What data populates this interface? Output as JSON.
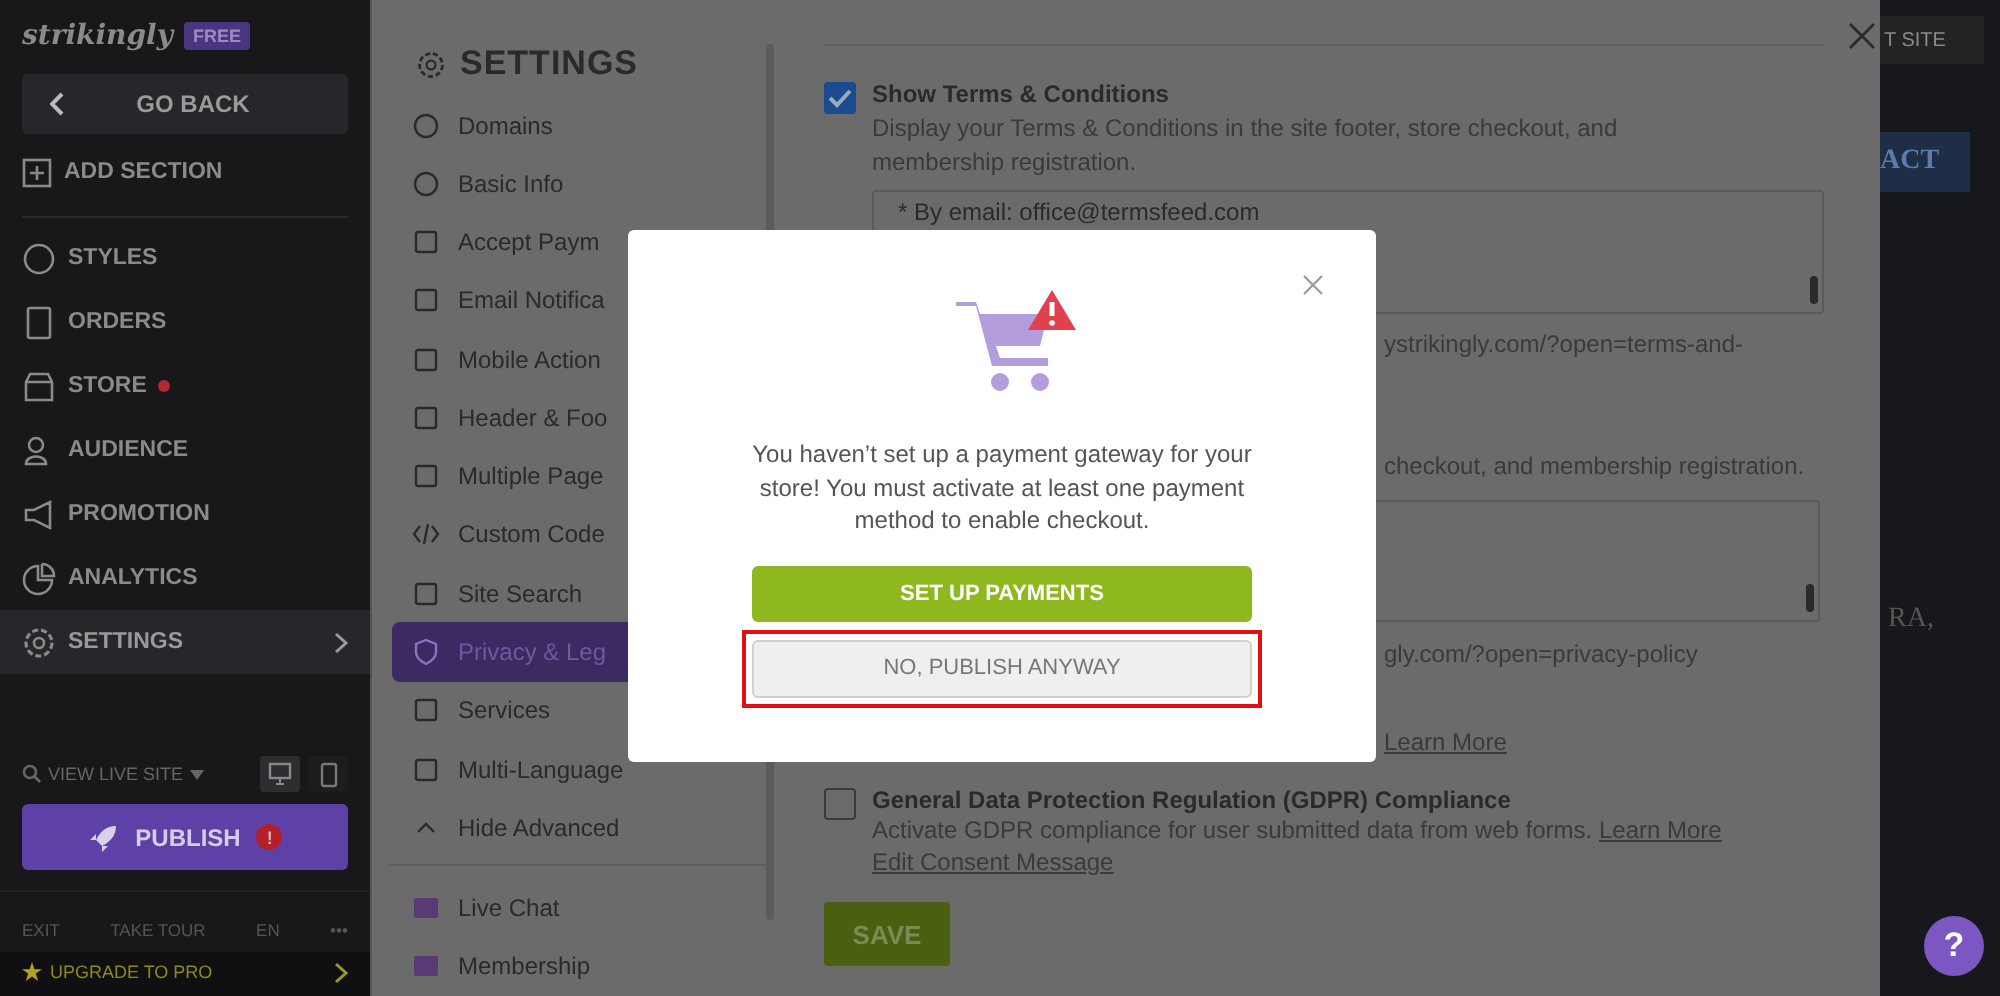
{
  "sidebar": {
    "logo": "strikingly",
    "plan_badge": "FREE",
    "back_button": "GO BACK",
    "add_section": "ADD SECTION",
    "items": [
      {
        "label": "STYLES",
        "selected": false,
        "alert": false
      },
      {
        "label": "ORDERS",
        "selected": false,
        "alert": false
      },
      {
        "label": "STORE",
        "selected": false,
        "alert": true
      },
      {
        "label": "AUDIENCE",
        "selected": false,
        "alert": false
      },
      {
        "label": "PROMOTION",
        "selected": false,
        "alert": false
      },
      {
        "label": "ANALYTICS",
        "selected": false,
        "alert": false
      },
      {
        "label": "SETTINGS",
        "selected": true,
        "alert": false
      }
    ],
    "view_live_site": "VIEW LIVE SITE",
    "devices": [
      {
        "kind": "desktop",
        "selected": true
      },
      {
        "kind": "mobile",
        "selected": false
      }
    ],
    "publish": {
      "label": "PUBLISH",
      "alert": "!"
    },
    "footer_links": [
      "EXIT",
      "TAKE TOUR",
      "EN",
      "•••"
    ],
    "upgrade": "UPGRADE TO PRO"
  },
  "settings_nav": {
    "title": "SETTINGS",
    "items": [
      {
        "label": "Domains",
        "selected": false
      },
      {
        "label": "Basic Info",
        "selected": false
      },
      {
        "label": "Accept Paym",
        "selected": false
      },
      {
        "label": "Email Notifica",
        "selected": false
      },
      {
        "label": "Mobile Action",
        "selected": false
      },
      {
        "label": "Header & Foo",
        "selected": false
      },
      {
        "label": "Multiple Page",
        "selected": false
      },
      {
        "label": "Custom Code",
        "selected": false
      },
      {
        "label": "Site Search",
        "selected": false
      },
      {
        "label": "Privacy & Leg",
        "selected": true
      },
      {
        "label": "Services",
        "selected": false
      },
      {
        "label": "Multi-Language",
        "selected": false
      },
      {
        "label": "Hide Advanced",
        "selected": false
      }
    ],
    "extra_items": [
      "Live Chat",
      "Membership"
    ]
  },
  "content": {
    "terms": {
      "label": "Show Terms & Conditions",
      "checked": true,
      "description": "Display your Terms & Conditions in the site footer, store checkout, and membership registration.",
      "textarea": "* By email: office@termsfeed.com",
      "link_fragment": "ystrikingly.com/?open=terms-and-"
    },
    "privacy": {
      "description_fragment": "checkout, and membership registration.",
      "link_fragment": "gly.com/?open=privacy-policy",
      "learn_more": "Learn More"
    },
    "gdpr": {
      "label": "General Data Protection Regulation (GDPR) Compliance",
      "checked": false,
      "description": "Activate GDPR compliance for user submitted data from web forms.",
      "learn_more": "Learn More",
      "edit_link": "Edit Consent Message"
    },
    "save_button": "SAVE"
  },
  "preview": {
    "button": "T SITE",
    "cta": "ACT",
    "text": "RA,",
    "help_button": "?"
  },
  "modal": {
    "message": "You haven’t set up a payment gateway for your store! You must activate at least one payment method to enable checkout.",
    "primary_button": "SET UP PAYMENTS",
    "secondary_button": "NO, PUBLISH ANYWAY",
    "secondary_highlighted": true
  }
}
